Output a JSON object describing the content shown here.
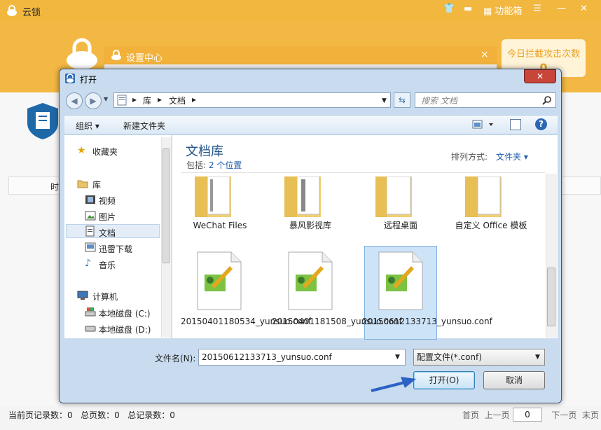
{
  "app": {
    "title": "云锁",
    "feature_box_label": "功能箱",
    "blocked_label": "今日拦截攻击次数",
    "blocked_count": "0",
    "table_header_partial": "时",
    "status": {
      "current_records_label": "当前页记录数：",
      "current_records": "0",
      "total_pages_label": "总页数：",
      "total_pages": "0",
      "total_records_label": "总记录数：",
      "total_records": "0"
    },
    "pager": {
      "first": "首页",
      "prev": "上一页",
      "page_value": "0",
      "next": "下一页",
      "last": "末页"
    }
  },
  "settings_dialog": {
    "title": "设置中心",
    "close": "×"
  },
  "open_dialog": {
    "title": "打开",
    "close": "✕",
    "address": [
      "库",
      "文档"
    ],
    "search_placeholder": "搜索 文档",
    "organize_label": "组织 ▾",
    "new_folder_label": "新建文件夹",
    "help_label": "?",
    "nav_items": [
      {
        "label": "收藏夹",
        "icon": "star-icon"
      },
      {
        "label": "库",
        "icon": "library-icon"
      },
      {
        "label": "视频",
        "icon": "video-icon"
      },
      {
        "label": "图片",
        "icon": "picture-icon"
      },
      {
        "label": "文档",
        "icon": "document-icon"
      },
      {
        "label": "迅雷下载",
        "icon": "download-icon"
      },
      {
        "label": "音乐",
        "icon": "music-icon"
      },
      {
        "label": "计算机",
        "icon": "computer-icon"
      },
      {
        "label": "本地磁盘 (C:)",
        "icon": "drive-c-icon"
      },
      {
        "label": "本地磁盘 (D:)",
        "icon": "drive-d-icon"
      }
    ],
    "library_title": "文档库",
    "includes_label": "包括:",
    "includes_link": "2 个位置",
    "sort_label": "排列方式:",
    "sort_value": "文件夹 ▾",
    "folders": [
      {
        "label": "WeChat Files"
      },
      {
        "label": "暴风影视库"
      },
      {
        "label": "远程桌面"
      },
      {
        "label": "自定义 Office 模板"
      }
    ],
    "files": [
      {
        "label": "20150401180534_yunsuo.conf"
      },
      {
        "label": "20150401181508_yunsuo.conf"
      },
      {
        "label": "20150612133713_yunsuo.conf",
        "selected": true
      }
    ],
    "filename_label": "文件名(N):",
    "filename_value": "20150612133713_yunsuo.conf",
    "filetype_value": "配置文件(*.conf)",
    "open_button": "打开(O)",
    "cancel_button": "取消"
  },
  "colors": {
    "app_orange": "#f2b73f",
    "dialog_frame": "#c9dcef",
    "link_blue": "#1f5ca9",
    "annotation_arrow": "#2b62c4"
  }
}
